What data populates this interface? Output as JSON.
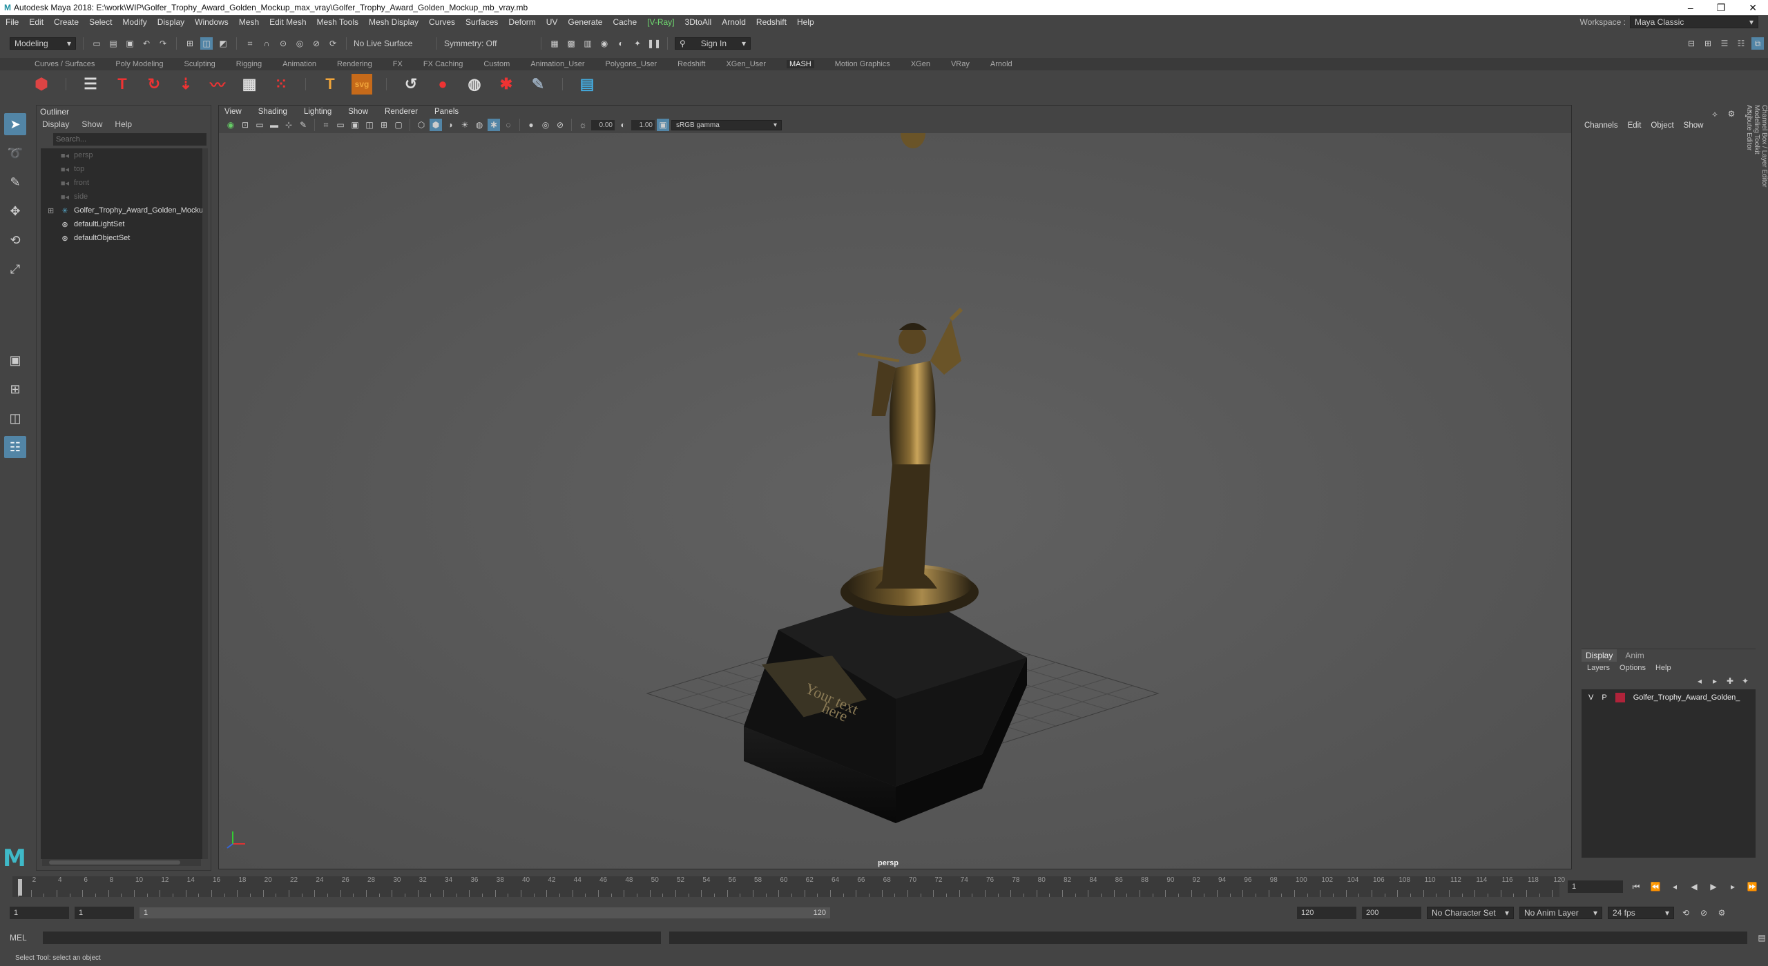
{
  "titlebar": {
    "text": "Autodesk Maya 2018: E:\\work\\WIP\\Golfer_Trophy_Award_Golden_Mockup_max_vray\\Golfer_Trophy_Award_Golden_Mockup_mb_vray.mb"
  },
  "menubar": {
    "items": [
      "File",
      "Edit",
      "Create",
      "Select",
      "Modify",
      "Display",
      "Windows",
      "Mesh",
      "Edit Mesh",
      "Mesh Tools",
      "Mesh Display",
      "Curves",
      "Surfaces",
      "Deform",
      "UV",
      "Generate",
      "Cache"
    ],
    "vray": "V-Ray",
    "items2": [
      "3DtoAll",
      "Arnold",
      "Redshift",
      "Help"
    ],
    "workspace_label": "Workspace :",
    "workspace_value": "Maya Classic"
  },
  "statusline": {
    "mode": "Modeling",
    "live_surface": "No Live Surface",
    "symmetry": "Symmetry: Off",
    "sign_in": "Sign In"
  },
  "shelf_tabs": [
    "Curves / Surfaces",
    "Poly Modeling",
    "Sculpting",
    "Rigging",
    "Animation",
    "Rendering",
    "FX",
    "FX Caching",
    "Custom",
    "Animation_User",
    "Polygons_User",
    "Redshift",
    "XGen_User",
    "MASH",
    "Motion Graphics",
    "XGen",
    "VRay",
    "Arnold"
  ],
  "shelf_active": "MASH",
  "outliner": {
    "title": "Outliner",
    "menu": [
      "Display",
      "Show",
      "Help"
    ],
    "search_placeholder": "Search...",
    "items": [
      {
        "label": "persp",
        "dim": true
      },
      {
        "label": "top",
        "dim": true
      },
      {
        "label": "front",
        "dim": true
      },
      {
        "label": "side",
        "dim": true
      },
      {
        "label": "Golfer_Trophy_Award_Golden_Mocku",
        "dim": false
      },
      {
        "label": "defaultLightSet",
        "dim": false
      },
      {
        "label": "defaultObjectSet",
        "dim": false
      }
    ]
  },
  "viewport": {
    "menu": [
      "View",
      "Shading",
      "Lighting",
      "Show",
      "Renderer",
      "Panels"
    ],
    "field1": "0.00",
    "field2": "1.00",
    "color_space": "sRGB gamma",
    "camera": "persp",
    "plaque_text": "Your text here"
  },
  "channelbox": {
    "menu": [
      "Channels",
      "Edit",
      "Object",
      "Show"
    ]
  },
  "layer_editor": {
    "tabs": [
      "Display",
      "Anim"
    ],
    "menu": [
      "Layers",
      "Options",
      "Help"
    ],
    "layer": {
      "v": "V",
      "p": "P",
      "name": "Golfer_Trophy_Award_Golden_",
      "color": "#b0233a"
    }
  },
  "side_tabs": [
    "Channel Box / Layer Editor",
    "Modeling Toolkit",
    "Attribute Editor"
  ],
  "timeline": {
    "labels": [
      "2",
      "4",
      "6",
      "8",
      "10",
      "12",
      "14",
      "16",
      "18",
      "20",
      "22",
      "24",
      "26",
      "28",
      "30",
      "32",
      "34",
      "36",
      "38",
      "40",
      "42",
      "44",
      "46",
      "48",
      "50",
      "52",
      "54",
      "56",
      "58",
      "60",
      "62",
      "64",
      "66",
      "68",
      "70",
      "72",
      "74",
      "76",
      "78",
      "80",
      "82",
      "84",
      "86",
      "88",
      "90",
      "92",
      "94",
      "96",
      "98",
      "100",
      "102",
      "104",
      "106",
      "108",
      "110",
      "112",
      "114",
      "116",
      "118",
      "120"
    ],
    "current_frame": "1"
  },
  "range": {
    "start": "1",
    "start2": "1",
    "slider_start": "1",
    "slider_end": "120",
    "end": "120",
    "end2": "200",
    "char_set": "No Character Set",
    "anim_layer": "No Anim Layer",
    "fps": "24 fps"
  },
  "cmdline": {
    "label": "MEL"
  },
  "helpline": {
    "text": "Select Tool: select an object"
  }
}
